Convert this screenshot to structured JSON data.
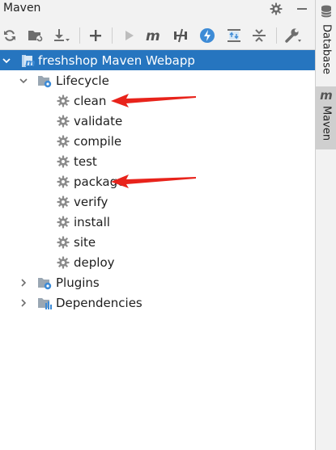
{
  "panel": {
    "title": "Maven"
  },
  "header_icons": [
    "gear-icon",
    "minimize-icon"
  ],
  "toolbar": {
    "buttons": [
      {
        "name": "reload-all-projects-icon"
      },
      {
        "name": "generate-sources-icon"
      },
      {
        "name": "download-sources-icon"
      },
      {
        "name": "add-maven-project-icon"
      },
      {
        "name": "run-maven-build-icon"
      },
      {
        "name": "execute-maven-goal-icon"
      },
      {
        "name": "toggle-offline-mode-icon"
      },
      {
        "name": "toggle-skip-tests-icon"
      },
      {
        "name": "show-dependencies-icon"
      },
      {
        "name": "collapse-all-icon"
      },
      {
        "name": "maven-settings-icon"
      }
    ]
  },
  "stripe": {
    "database_label": "Database",
    "maven_label": "Maven",
    "maven_glyph": "m"
  },
  "tree": {
    "project": "freshshop Maven Webapp",
    "lifecycle": {
      "label": "Lifecycle",
      "goals": [
        "clean",
        "validate",
        "compile",
        "test",
        "package",
        "verify",
        "install",
        "site",
        "deploy"
      ]
    },
    "plugins": "Plugins",
    "dependencies": "Dependencies"
  },
  "annotations": {
    "arrow_color": "#e8231b",
    "pointed_goals": [
      "clean",
      "package"
    ]
  },
  "colors": {
    "selection": "#2675bf",
    "gear": "#8c8c8c",
    "maven_blue": "#3d8bd6"
  }
}
